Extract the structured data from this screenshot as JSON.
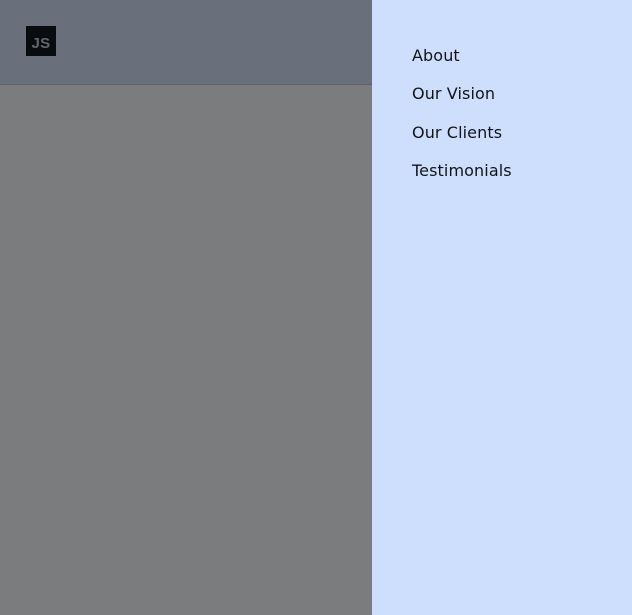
{
  "header": {
    "logo_text": "JS"
  },
  "drawer": {
    "items": [
      {
        "label": "About"
      },
      {
        "label": "Our Vision"
      },
      {
        "label": "Our Clients"
      },
      {
        "label": "Testimonials"
      }
    ]
  },
  "colors": {
    "drawer_background": "#cedffe",
    "overlay": "rgba(0,0,0,0.5)",
    "logo_background": "#111820"
  }
}
